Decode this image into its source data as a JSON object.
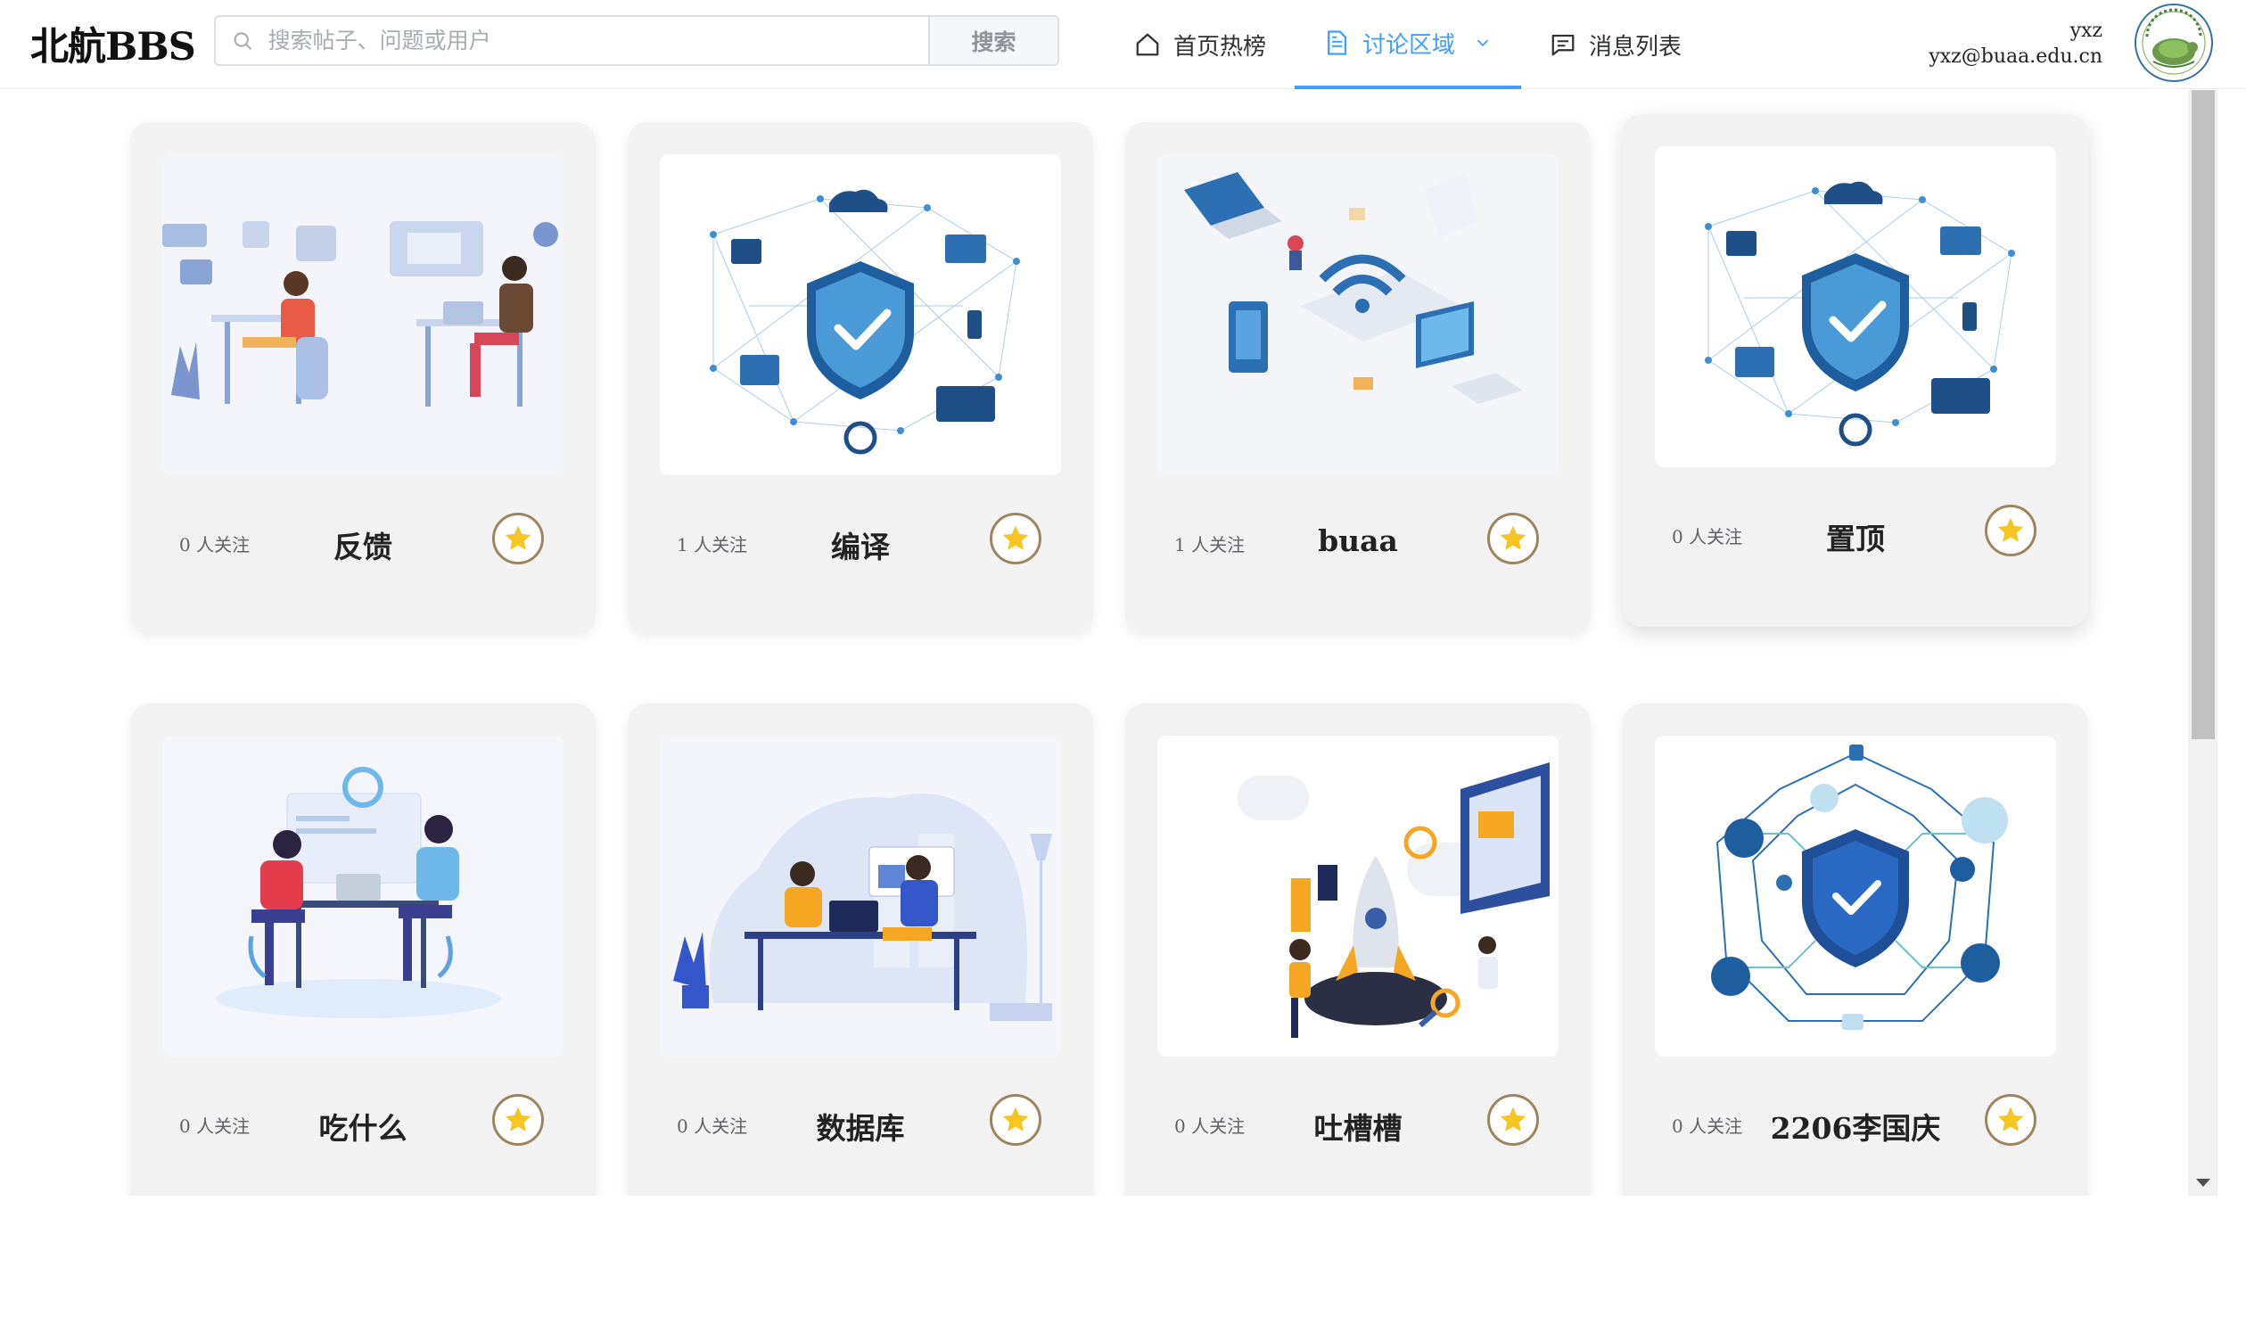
{
  "header": {
    "logo": "北航BBS",
    "search": {
      "placeholder": "搜索帖子、问题或用户",
      "value": "",
      "button_label": "搜索"
    },
    "nav": [
      {
        "label": "首页热榜",
        "icon": "home-icon",
        "active": false
      },
      {
        "label": "讨论区域",
        "icon": "document-icon",
        "active": true,
        "has_dropdown": true
      },
      {
        "label": "消息列表",
        "icon": "message-icon",
        "active": false
      }
    ],
    "user": {
      "name": "yxz",
      "email": "yxz@buaa.edu.cn",
      "avatar_icon": "university-seal-icon"
    }
  },
  "colors": {
    "accent": "#409eff",
    "card_bg": "#f2f2f2",
    "star": "#f7c520",
    "star_border": "#9c8560"
  },
  "boards": [
    {
      "followers": "0 人关注",
      "title": "反馈",
      "illustration": "two-people-working-illustration"
    },
    {
      "followers": "1 人关注",
      "title": "编译",
      "illustration": "security-shield-network-illustration"
    },
    {
      "followers": "1 人关注",
      "title": "buaa",
      "illustration": "isometric-wifi-devices-illustration"
    },
    {
      "followers": "0 人关注",
      "title": "置顶",
      "illustration": "security-shield-network-illustration"
    },
    {
      "followers": "0 人关注",
      "title": "吃什么",
      "illustration": "meeting-table-illustration"
    },
    {
      "followers": "0 人关注",
      "title": "数据库",
      "illustration": "office-desk-team-illustration"
    },
    {
      "followers": "0 人关注",
      "title": "吐槽槽",
      "illustration": "rocket-project-illustration"
    },
    {
      "followers": "0 人关注",
      "title": "2206李国庆",
      "illustration": "shield-circuit-illustration"
    }
  ]
}
